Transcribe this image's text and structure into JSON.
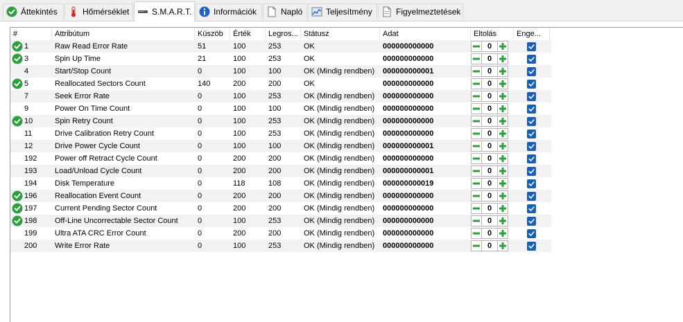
{
  "tabs": [
    {
      "label": "Áttekintés",
      "icon": "check-circle-icon",
      "active": false
    },
    {
      "label": "Hőmérséklet",
      "icon": "thermometer-icon",
      "active": false
    },
    {
      "label": "S.M.A.R.T.",
      "icon": "drive-icon",
      "active": true
    },
    {
      "label": "Információk",
      "icon": "info-icon",
      "active": false
    },
    {
      "label": "Napló",
      "icon": "document-icon",
      "active": false
    },
    {
      "label": "Teljesítmény",
      "icon": "performance-chart-icon",
      "active": false
    },
    {
      "label": "Figyelmeztetések",
      "icon": "alert-document-icon",
      "active": false
    }
  ],
  "table": {
    "columns": {
      "id": "#",
      "attr": "Attribútum",
      "threshold": "Küszöb",
      "value": "Érték",
      "worst": "Legros...",
      "status": "Státusz",
      "data": "Adat",
      "offset": "Eltolás",
      "enabled": "Enge..."
    },
    "rows": [
      {
        "ok": true,
        "id": "1",
        "attr": "Raw Read Error Rate",
        "threshold": "51",
        "value": "100",
        "worst": "253",
        "status": "OK",
        "data": "000000000000",
        "offset": "0",
        "enabled": true
      },
      {
        "ok": true,
        "id": "3",
        "attr": "Spin Up Time",
        "threshold": "21",
        "value": "100",
        "worst": "253",
        "status": "OK",
        "data": "000000000000",
        "offset": "0",
        "enabled": true
      },
      {
        "ok": false,
        "id": "4",
        "attr": "Start/Stop Count",
        "threshold": "0",
        "value": "100",
        "worst": "100",
        "status": "OK (Mindig rendben)",
        "data": "000000000001",
        "offset": "0",
        "enabled": true
      },
      {
        "ok": true,
        "id": "5",
        "attr": "Reallocated Sectors Count",
        "threshold": "140",
        "value": "200",
        "worst": "200",
        "status": "OK",
        "data": "000000000000",
        "offset": "0",
        "enabled": true
      },
      {
        "ok": false,
        "id": "7",
        "attr": "Seek Error Rate",
        "threshold": "0",
        "value": "100",
        "worst": "253",
        "status": "OK (Mindig rendben)",
        "data": "000000000000",
        "offset": "0",
        "enabled": true
      },
      {
        "ok": false,
        "id": "9",
        "attr": "Power On Time Count",
        "threshold": "0",
        "value": "100",
        "worst": "100",
        "status": "OK (Mindig rendben)",
        "data": "000000000000",
        "offset": "0",
        "enabled": true
      },
      {
        "ok": true,
        "id": "10",
        "attr": "Spin Retry Count",
        "threshold": "0",
        "value": "100",
        "worst": "253",
        "status": "OK (Mindig rendben)",
        "data": "000000000000",
        "offset": "0",
        "enabled": true
      },
      {
        "ok": false,
        "id": "11",
        "attr": "Drive Calibration Retry Count",
        "threshold": "0",
        "value": "100",
        "worst": "253",
        "status": "OK (Mindig rendben)",
        "data": "000000000000",
        "offset": "0",
        "enabled": true
      },
      {
        "ok": false,
        "id": "12",
        "attr": "Drive Power Cycle Count",
        "threshold": "0",
        "value": "100",
        "worst": "100",
        "status": "OK (Mindig rendben)",
        "data": "000000000001",
        "offset": "0",
        "enabled": true
      },
      {
        "ok": false,
        "id": "192",
        "attr": "Power off Retract Cycle Count",
        "threshold": "0",
        "value": "200",
        "worst": "200",
        "status": "OK (Mindig rendben)",
        "data": "000000000000",
        "offset": "0",
        "enabled": true
      },
      {
        "ok": false,
        "id": "193",
        "attr": "Load/Unload Cycle Count",
        "threshold": "0",
        "value": "200",
        "worst": "200",
        "status": "OK (Mindig rendben)",
        "data": "000000000001",
        "offset": "0",
        "enabled": true
      },
      {
        "ok": false,
        "id": "194",
        "attr": "Disk Temperature",
        "threshold": "0",
        "value": "118",
        "worst": "108",
        "status": "OK (Mindig rendben)",
        "data": "000000000019",
        "offset": "0",
        "enabled": true
      },
      {
        "ok": true,
        "id": "196",
        "attr": "Reallocation Event Count",
        "threshold": "0",
        "value": "200",
        "worst": "200",
        "status": "OK (Mindig rendben)",
        "data": "000000000000",
        "offset": "0",
        "enabled": true
      },
      {
        "ok": true,
        "id": "197",
        "attr": "Current Pending Sector Count",
        "threshold": "0",
        "value": "200",
        "worst": "200",
        "status": "OK (Mindig rendben)",
        "data": "000000000000",
        "offset": "0",
        "enabled": true
      },
      {
        "ok": true,
        "id": "198",
        "attr": "Off-Line Uncorrectable Sector Count",
        "threshold": "0",
        "value": "100",
        "worst": "253",
        "status": "OK (Mindig rendben)",
        "data": "000000000000",
        "offset": "0",
        "enabled": true
      },
      {
        "ok": false,
        "id": "199",
        "attr": "Ultra ATA CRC Error Count",
        "threshold": "0",
        "value": "200",
        "worst": "200",
        "status": "OK (Mindig rendben)",
        "data": "000000000000",
        "offset": "0",
        "enabled": true
      },
      {
        "ok": false,
        "id": "200",
        "attr": "Write Error Rate",
        "threshold": "0",
        "value": "100",
        "worst": "253",
        "status": "OK (Mindig rendben)",
        "data": "000000000000",
        "offset": "0",
        "enabled": true
      }
    ]
  },
  "colors": {
    "ok_green": "#2e9e3e",
    "minus_green": "#2e9e3e",
    "plus_green": "#2e9e3e",
    "checkbox_blue": "#1a5fb4",
    "alt_row": "#f2f2f2"
  }
}
